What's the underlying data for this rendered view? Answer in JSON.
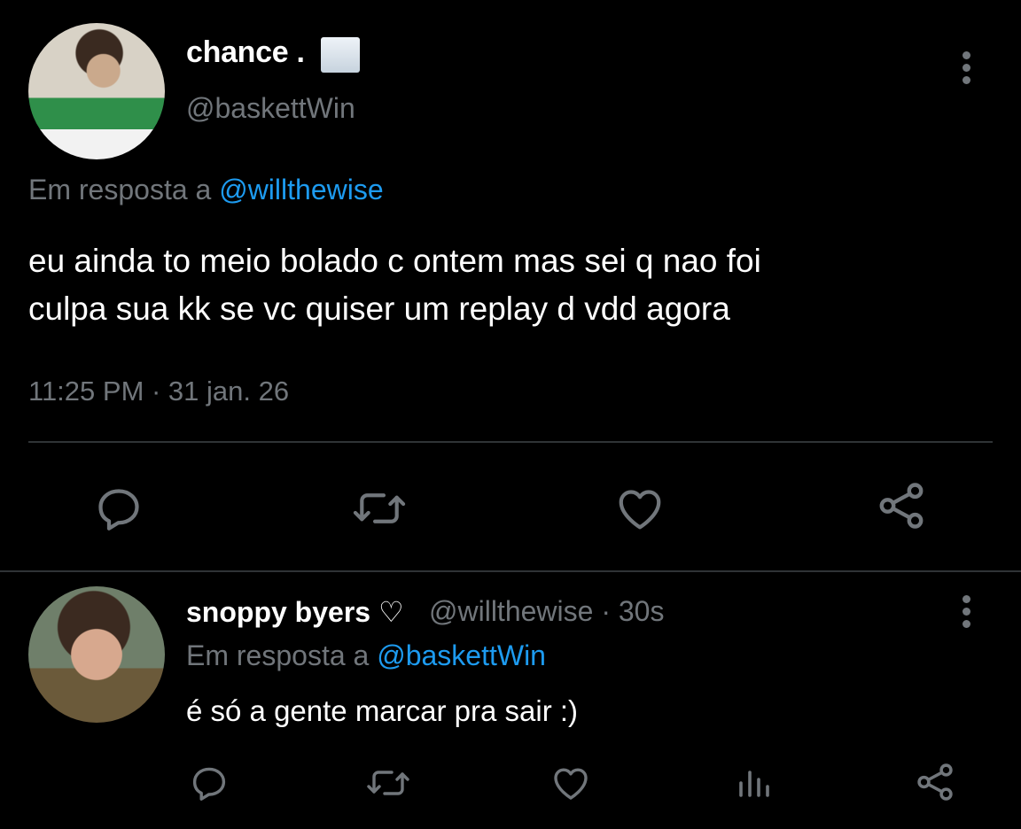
{
  "main_tweet": {
    "display_name": "chance .",
    "handle": "@baskettWin",
    "replying_prefix": "Em resposta a",
    "replying_to": "@willthewise",
    "text_line1": "eu ainda to meio bolado c ontem mas sei q nao foi",
    "text_line2": "culpa sua kk se vc quiser um replay d vdd agora",
    "timestamp": "11:25 PM · 31 jan. 26",
    "actions": [
      "reply-icon",
      "retweet-icon",
      "like-icon",
      "share-icon"
    ]
  },
  "reply_tweet": {
    "display_name": "snoppy byers ♡",
    "handle_time": "@willthewise · 30s",
    "replying_prefix": "Em resposta a",
    "replying_to": "@baskettWin",
    "text": "é só a gente marcar pra sair :)",
    "actions": [
      "reply-icon",
      "retweet-icon",
      "like-icon",
      "analytics-icon",
      "share-icon"
    ]
  },
  "colors": {
    "background": "#000000",
    "text_primary": "#ffffff",
    "text_secondary": "#71767b",
    "accent": "#1d9bf0",
    "divider": "#2f3336"
  }
}
